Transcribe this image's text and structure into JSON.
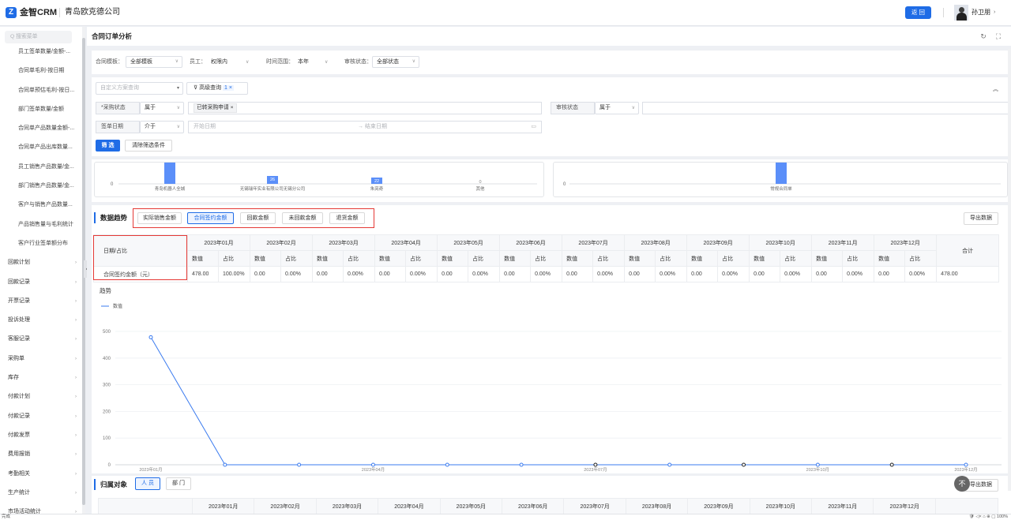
{
  "header": {
    "logo_mark": "Z",
    "logo_text": "金智CRM",
    "company": "青岛欧克德公司",
    "back_button": "返 回",
    "user_name": "孙卫朋",
    "user_caret": "›"
  },
  "sidebar": {
    "search_placeholder": "Q 搜索菜单",
    "sub_items": [
      "员工签单数量/金额-...",
      "合同单毛利-按日期",
      "合同单预估毛利-按日...",
      "部门签单数量/金额",
      "合同单产品数量金额-...",
      "合同单产品出库数量...",
      "员工销售产品数量/金...",
      "部门销售产品数量/金...",
      "客户与销售产品数量...",
      "产品销售量与毛利统计",
      "客户行业签单额分布"
    ],
    "top_items": [
      "回款计划",
      "回款记录",
      "开票记录",
      "投诉处理",
      "客服记录",
      "采购单",
      "库存",
      "付款计划",
      "付款记录",
      "付款发票",
      "费用报销",
      "考勤相关",
      "生产统计",
      "市场活动统计"
    ],
    "arrow": "›",
    "collapse": "‹"
  },
  "page": {
    "title": "合同订单分析",
    "refresh_icon": "↻",
    "fullscreen_icon": "⛶"
  },
  "filters": {
    "template_label": "合同模板：",
    "template_value": "全部模板",
    "staff_label": "员工：",
    "staff_value": "权限内",
    "time_label": "时间范围：",
    "time_value": "本年",
    "audit_label": "审核状态：",
    "audit_value": "全部状态",
    "scheme_placeholder": "自定义方案查询",
    "advanced_label": "高级查询",
    "advanced_count": "1 ×",
    "purchase_status_label": "*采购状态",
    "purchase_op": "属于",
    "purchase_tag": "已转采购申请 ×",
    "audit2_label": "审核状态",
    "audit2_op": "属于",
    "sign_date_label": "签单日期",
    "sign_op": "介于",
    "start_placeholder": "开始日期",
    "end_placeholder": "→ 结束日期",
    "filter_button": "筛 选",
    "clear_button": "清除筛选条件",
    "collapse_icon": "︽",
    "calendar_icon": "▭"
  },
  "mini_chart_left": {
    "categories": [
      "青岛机器人全城",
      "无锡瑞年实业有限公司无锡分公司",
      "朱亮奇",
      "其他"
    ],
    "labels": [
      "",
      "26",
      "22",
      "0"
    ],
    "zero": "0"
  },
  "mini_chart_right": {
    "categories": [
      "常规合同单"
    ],
    "zero": "0"
  },
  "trend": {
    "title": "数据趋势",
    "tabs": [
      "实际销售金额",
      "合同签约金额",
      "回款金额",
      "未回款金额",
      "退货金额"
    ],
    "export": "导出数据",
    "corner_header": "日期/占比",
    "months": [
      "2023年01月",
      "2023年02月",
      "2023年03月",
      "2023年04月",
      "2023年05月",
      "2023年06月",
      "2023年07月",
      "2023年08月",
      "2023年09月",
      "2023年10月",
      "2023年11月",
      "2023年12月"
    ],
    "sub_value": "数值",
    "sub_ratio": "占比",
    "total_header": "合计",
    "row_label": "合同签约金额（元）",
    "values": [
      "478.00",
      "0.00",
      "0.00",
      "0.00",
      "0.00",
      "0.00",
      "0.00",
      "0.00",
      "0.00",
      "0.00",
      "0.00",
      "0.00"
    ],
    "ratios": [
      "100.00%",
      "0.00%",
      "0.00%",
      "0.00%",
      "0.00%",
      "0.00%",
      "0.00%",
      "0.00%",
      "0.00%",
      "0.00%",
      "0.00%",
      "0.00%"
    ],
    "total": "478.00",
    "chart_title": "趋势",
    "legend": "数值"
  },
  "chart_data": {
    "type": "line",
    "x": [
      "2023年01月",
      "2023年02月",
      "2023年03月",
      "2023年04月",
      "2023年05月",
      "2023年06月",
      "2023年07月",
      "2023年08月",
      "2023年09月",
      "2023年10月",
      "2023年11月",
      "2023年12月"
    ],
    "series": [
      {
        "name": "数值",
        "values": [
          478,
          0,
          0,
          0,
          0,
          0,
          0,
          0,
          0,
          0,
          0,
          0
        ]
      }
    ],
    "ylim": [
      0,
      500
    ],
    "yticks": [
      0,
      100,
      200,
      300,
      400,
      500
    ],
    "xtick_labels": [
      "2023年01月",
      "2023年04月",
      "2023年07月",
      "2023年10月",
      "2023年12月"
    ],
    "title": "趋势",
    "grid": true,
    "legend_position": "top-left",
    "color": "#3b7bef"
  },
  "owner": {
    "title": "归属对象",
    "tab_person": "人 员",
    "tab_dept": "部 门",
    "export": "导出数据",
    "float_icon": "不"
  },
  "statusbar": {
    "left": "完成",
    "right": "🛡 ◁× ⌂ ⊕ ▢ 100%"
  }
}
